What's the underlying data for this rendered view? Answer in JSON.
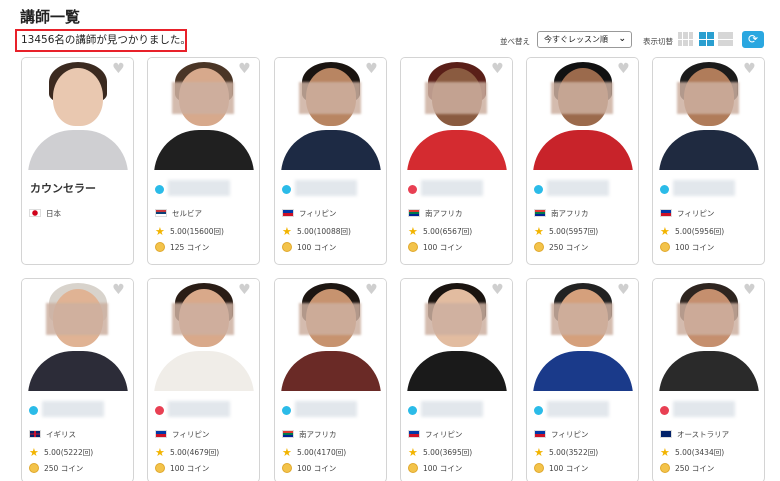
{
  "header": {
    "title": "講師一覧",
    "result_text": "13456名の講師が見つかりました。",
    "sort_label": "並べ替え",
    "sort_value": "今すぐレッスン順",
    "view_label": "表示切替",
    "refresh_icon": "refresh-icon"
  },
  "colors": {
    "online": "#2bbbe8",
    "busy": "#e84053",
    "accent": "#2aa7e0",
    "highlight_box": "#e8212a"
  },
  "teachers": [
    {
      "name": "カウンセラー",
      "country": "日本",
      "flag": "jp",
      "is_counselor": true
    },
    {
      "status": "online",
      "country": "セルビア",
      "flag": "rs",
      "rating": "5.00(15600回)",
      "coins": "125 コイン"
    },
    {
      "status": "online",
      "country": "フィリピン",
      "flag": "ph",
      "rating": "5.00(10088回)",
      "coins": "100 コイン"
    },
    {
      "status": "busy",
      "country": "南アフリカ",
      "flag": "za",
      "rating": "5.00(6567回)",
      "coins": "100 コイン"
    },
    {
      "status": "online",
      "country": "南アフリカ",
      "flag": "za",
      "rating": "5.00(5957回)",
      "coins": "250 コイン"
    },
    {
      "status": "online",
      "country": "フィリピン",
      "flag": "ph",
      "rating": "5.00(5956回)",
      "coins": "100 コイン"
    },
    {
      "status": "online",
      "country": "イギリス",
      "flag": "gb",
      "rating": "5.00(5222回)",
      "coins": "250 コイン"
    },
    {
      "status": "busy",
      "country": "フィリピン",
      "flag": "ph",
      "rating": "5.00(4679回)",
      "coins": "100 コイン"
    },
    {
      "status": "online",
      "country": "南アフリカ",
      "flag": "za",
      "rating": "5.00(4170回)",
      "coins": "100 コイン"
    },
    {
      "status": "online",
      "country": "フィリピン",
      "flag": "ph",
      "rating": "5.00(3695回)",
      "coins": "100 コイン"
    },
    {
      "status": "online",
      "country": "フィリピン",
      "flag": "ph",
      "rating": "5.00(3522回)",
      "coins": "100 コイン"
    },
    {
      "status": "busy",
      "country": "オーストラリア",
      "flag": "au",
      "rating": "5.00(3434回)",
      "coins": "250 コイン"
    }
  ]
}
